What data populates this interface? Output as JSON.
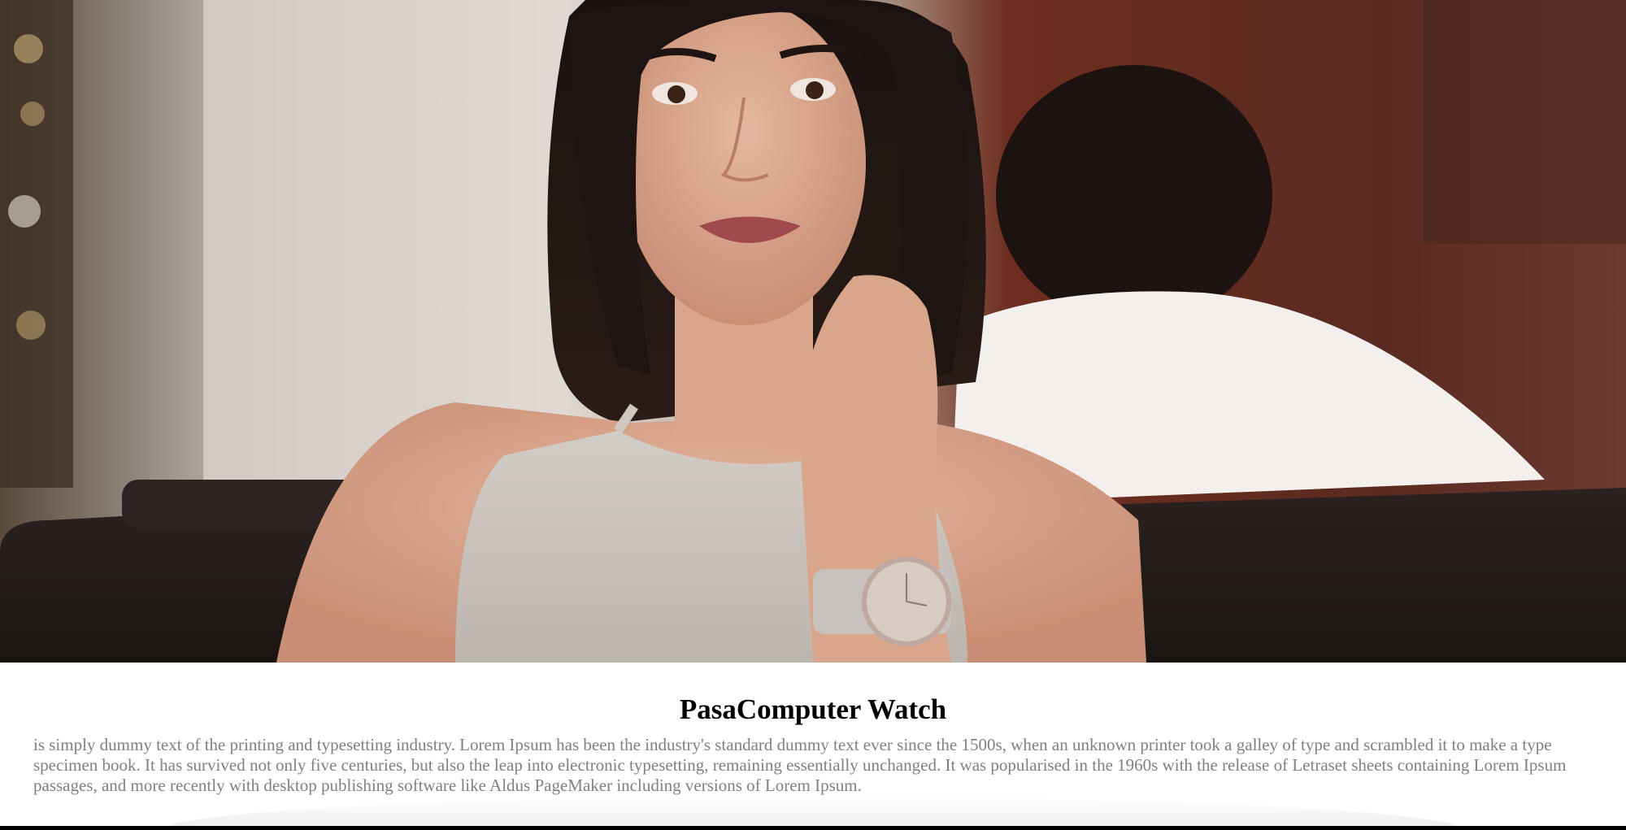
{
  "hero": {
    "image_description_icon": "woman-wearing-watch-photo"
  },
  "card": {
    "title": "PasaComputer Watch",
    "description": "is simply dummy text of the printing and typesetting industry. Lorem Ipsum has been the industry's standard dummy text ever since the 1500s, when an unknown printer took a galley of type and scrambled it to make a type specimen book. It has survived not only five centuries, but also the leap into electronic typesetting, remaining essentially unchanged. It was popularised in the 1960s with the release of Letraset sheets containing Lorem Ipsum passages, and more recently with desktop publishing software like Aldus PageMaker including versions of Lorem Ipsum."
  },
  "colors": {
    "title": "#000000",
    "body_text": "#808080",
    "background": "#ffffff"
  }
}
